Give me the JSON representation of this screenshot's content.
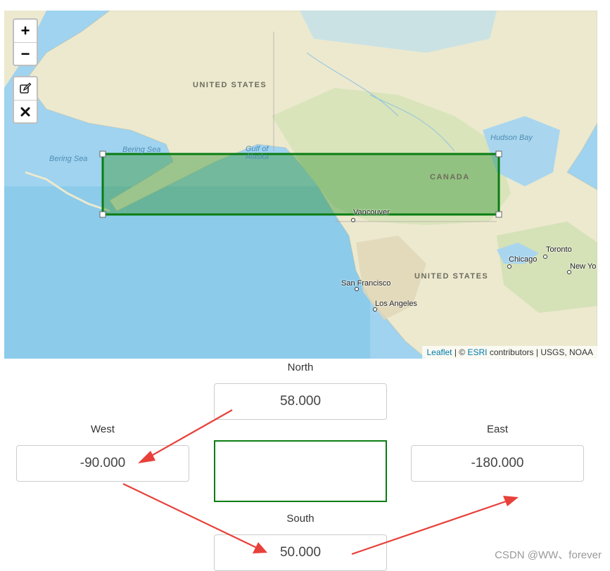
{
  "map": {
    "labels": {
      "united_states_top": "UNITED STATES",
      "united_states": "UNITED  STATES",
      "canada": "CANADA",
      "hudson_bay": "Hudson Bay",
      "bering_sea_left": "Bering Sea",
      "bering_sea_right": "Bering Sea",
      "gulf_of_alaska": "Gulf of\nAlaska",
      "vancouver": "Vancouver",
      "san_francisco": "San Francisco",
      "los_angeles": "Los Angeles",
      "chicago": "Chicago",
      "toronto": "Toronto",
      "new_york": "New Yo"
    },
    "zoom_in_icon": "plus-icon",
    "zoom_out_icon": "minus-icon",
    "edit_icon": "edit-pencil-icon",
    "delete_icon": "close-x-icon",
    "zoom_in_label": "+",
    "zoom_out_label": "−",
    "attribution": {
      "leaflet": "Leaflet",
      "sep": " | © ",
      "esri": "ESRI",
      "rest": " contributors | USGS, NOAA"
    },
    "rectangle_color": "#0a7d12"
  },
  "form": {
    "north_label": "North",
    "north_value": "58.000",
    "west_label": "West",
    "west_value": "-90.000",
    "east_label": "East",
    "east_value": "-180.000",
    "south_label": "South",
    "south_value": "50.000"
  },
  "watermark": "CSDN @WW、forever",
  "colors": {
    "arrow": "#e8403a",
    "rectangle": "#0a7d12"
  }
}
